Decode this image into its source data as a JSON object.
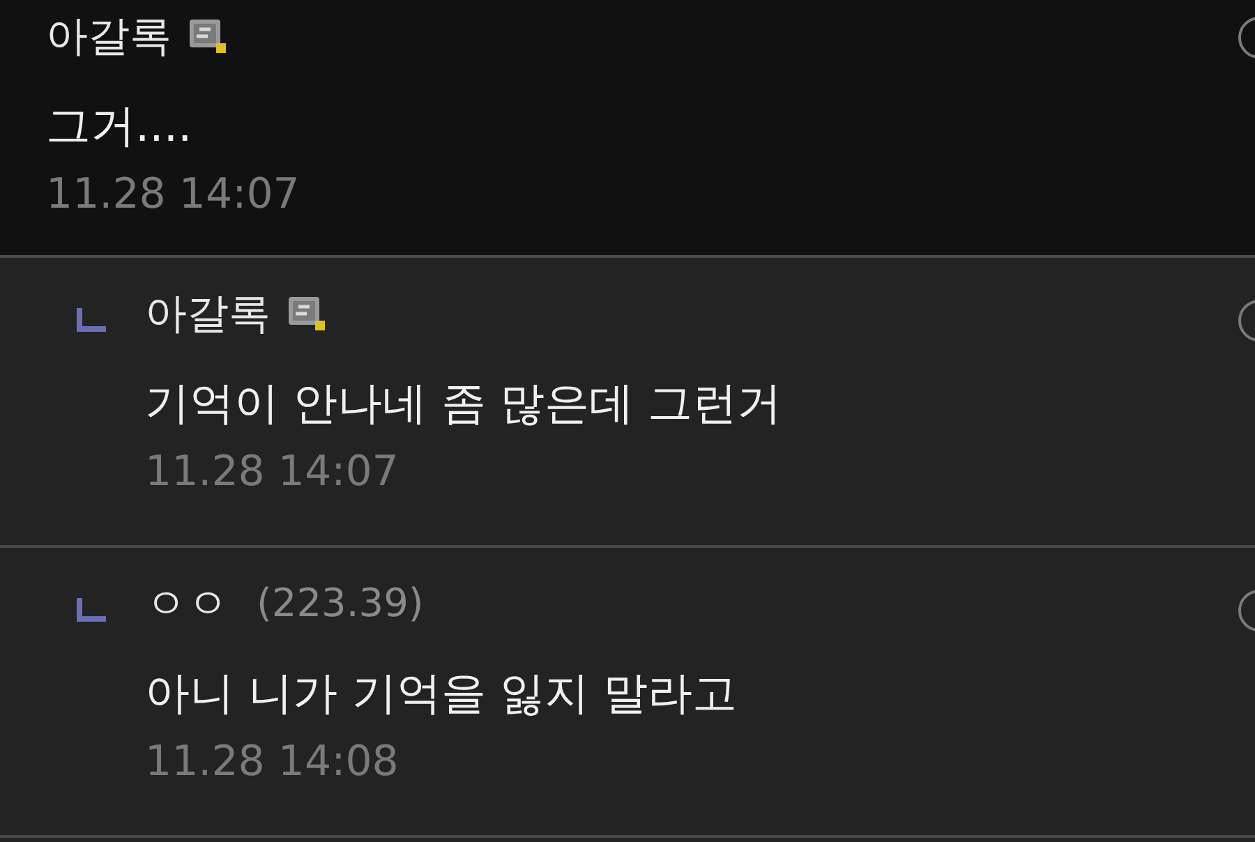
{
  "comments": [
    {
      "kind": "comment",
      "author": "아갈록",
      "badge": true,
      "text": "그거....",
      "time": "11.28 14:07"
    },
    {
      "kind": "reply",
      "author": "아갈록",
      "badge": true,
      "text": "기억이 안나네 좀 많은데 그런거",
      "time": "11.28 14:07"
    },
    {
      "kind": "reply",
      "author": "ㅇㅇ",
      "badge": false,
      "ip": "(223.39)",
      "text": "아니 니가 기억을 잃지 말라고",
      "time": "11.28 14:08"
    }
  ]
}
